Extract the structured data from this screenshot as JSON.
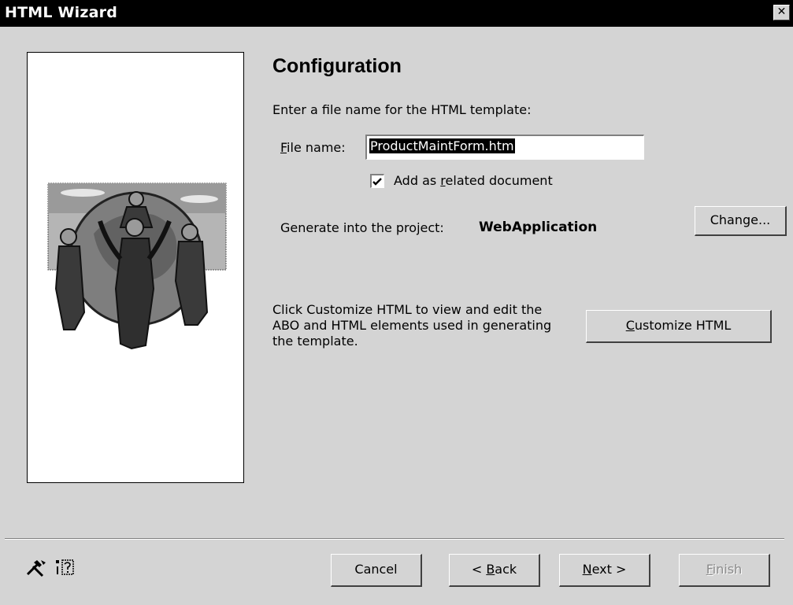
{
  "window": {
    "title": "HTML Wizard",
    "close_glyph": "✕"
  },
  "panel": {
    "image": "people-around-globe-illustration"
  },
  "page": {
    "heading": "Configuration",
    "instruction": "Enter a file name for the HTML template:",
    "file_label_accel": "F",
    "file_label_rest": "ile name:",
    "file_value": "ProductMaintForm.htm",
    "related_prefix": "Add as ",
    "related_accel": "r",
    "related_suffix": "elated document",
    "related_checked": true,
    "generate_label": "Generate into the project:",
    "project_name": "WebApplication",
    "change_button": "Change...",
    "customize_text_1": "Click Customize HTML to view and edit the",
    "customize_text_2": "ABO and HTML elements used in generating",
    "customize_text_3": "the template.",
    "customize_accel": "C",
    "customize_rest": "ustomize HTML"
  },
  "footer": {
    "icons": [
      "tools-icon",
      "help-icon"
    ],
    "cancel": "Cancel",
    "back_prefix": "< ",
    "back_accel": "B",
    "back_rest": "ack",
    "next_accel": "N",
    "next_rest": "ext >",
    "finish_accel": "F",
    "finish_rest": "inish",
    "finish_enabled": false
  },
  "colors": {
    "titlebar": "#000000",
    "dialog": "#d4d4d4",
    "selection": "#000000"
  }
}
